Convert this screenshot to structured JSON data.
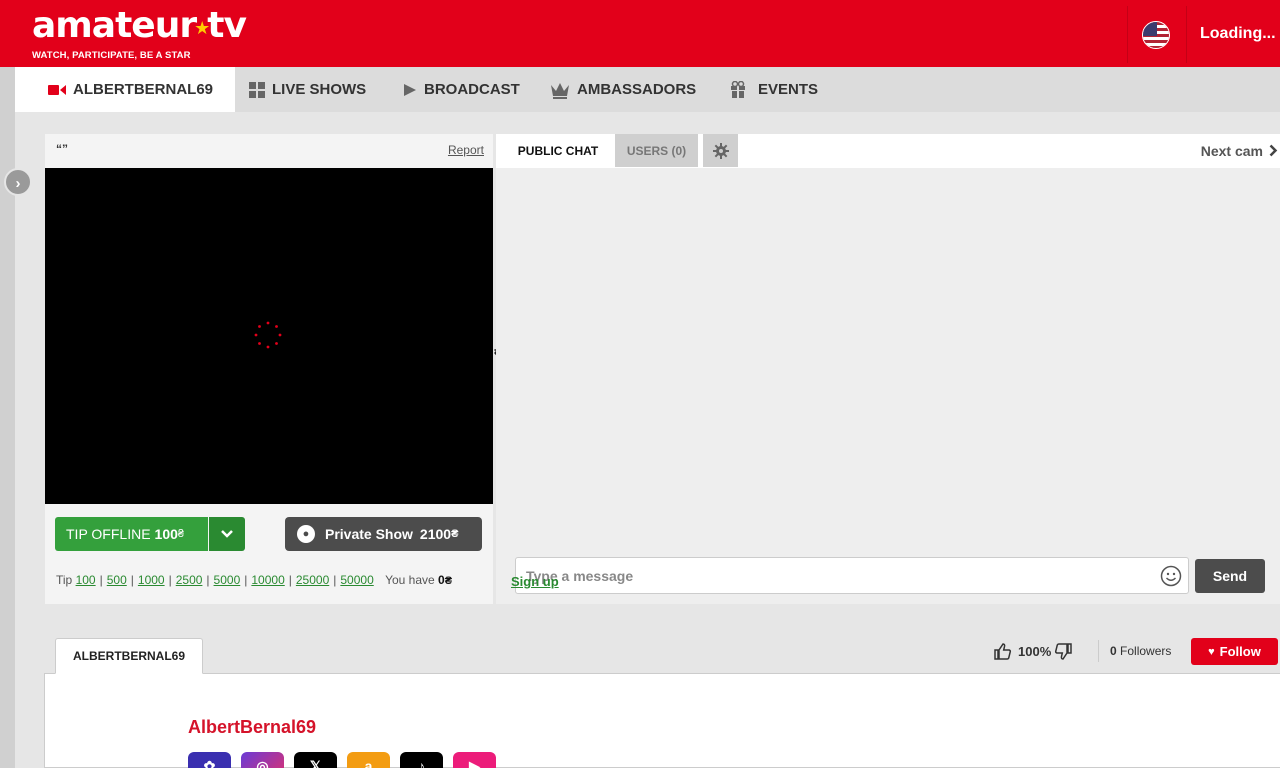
{
  "header": {
    "logo_text_1": "amateur",
    "logo_star": "★",
    "logo_text_2": "tv",
    "tagline": "WATCH, PARTICIPATE, BE A STAR",
    "loading": "Loading..."
  },
  "nav": {
    "items": [
      {
        "label": "ALBERTBERNAL69",
        "icon": "video-camera-icon"
      },
      {
        "label": "LIVE SHOWS",
        "icon": "grid-icon"
      },
      {
        "label": "BROADCAST",
        "icon": "play-icon"
      },
      {
        "label": "AMBASSADORS",
        "icon": "crown-icon"
      },
      {
        "label": "EVENTS",
        "icon": "gift-icon"
      }
    ]
  },
  "video": {
    "title": "“”",
    "report": "Report"
  },
  "tip": {
    "label": "TIP OFFLINE",
    "amount": "100",
    "coin": "₴",
    "private_label": "Private Show",
    "private_amount": "2100",
    "tip_prefix": "Tip",
    "quick_amounts": [
      "100",
      "500",
      "1000",
      "2500",
      "5000",
      "10000",
      "25000",
      "50000"
    ],
    "you_have": "You have",
    "balance": "0"
  },
  "chat": {
    "tab_public": "PUBLIC CHAT",
    "tab_users": "USERS (0)",
    "next_cam": "Next cam",
    "placeholder": "Type a message",
    "send": "Send",
    "signup": "Sign up"
  },
  "profile": {
    "tab_label": "ALBERTBERNAL69",
    "name": "AlbertBernal69",
    "rating": "100%",
    "followers_count": "0",
    "followers_label": "Followers",
    "follow": "Follow",
    "social_icons": [
      "settings-icon",
      "instagram-icon",
      "x-icon",
      "amazon-icon",
      "tiktok-icon",
      "onlyfans-icon"
    ]
  },
  "colors": {
    "brand_red": "#e2001a",
    "tip_green": "#34a03c",
    "dark_button": "#4c4c4c"
  }
}
